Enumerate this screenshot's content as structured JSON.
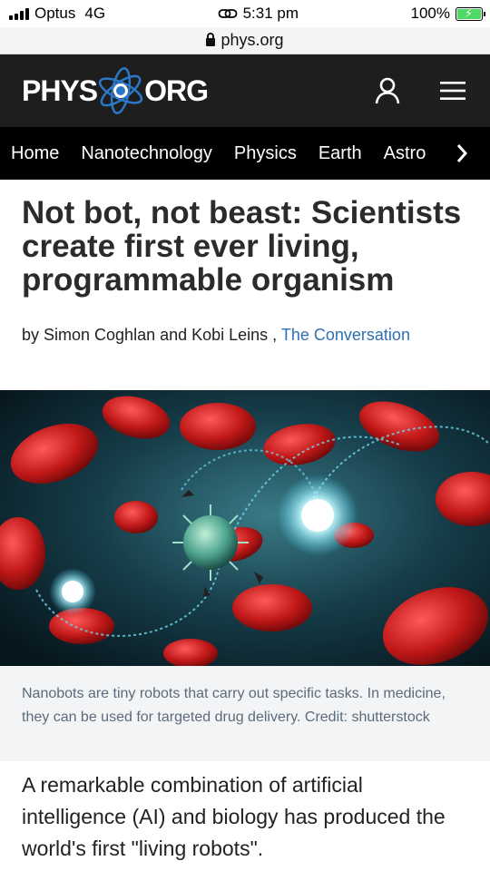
{
  "status_bar": {
    "carrier": "Optus",
    "network": "4G",
    "time": "5:31 pm",
    "battery": "100%"
  },
  "url_bar": {
    "url": "phys.org"
  },
  "header": {
    "logo_left": "PHYS",
    "logo_right": "ORG",
    "account_icon": "user-icon",
    "menu_icon": "hamburger-menu-icon"
  },
  "nav": {
    "items": [
      "Home",
      "Nanotechnology",
      "Physics",
      "Earth",
      "Astro"
    ],
    "next_icon": "chevron-right-icon"
  },
  "article": {
    "title": "Not bot, not beast: Scientists create first ever living, programmable organism",
    "byline_prefix": "by Simon Coghlan and Kobi Leins ,",
    "byline_source": "The Conversation",
    "image_caption": "Nanobots are tiny robots that carry out specific tasks. In medicine, they can be used for targeted drug delivery. Credit: shutterstock",
    "body_first": "A remarkable combination of artificial intelligence (AI) and biology has produced the world's first \"living robots\"."
  },
  "colors": {
    "header_bg": "#1e1e1e",
    "nav_bg": "#000000",
    "link": "#2f6fb6",
    "caption_bg": "#f3f4f5",
    "battery": "#4cd964"
  }
}
